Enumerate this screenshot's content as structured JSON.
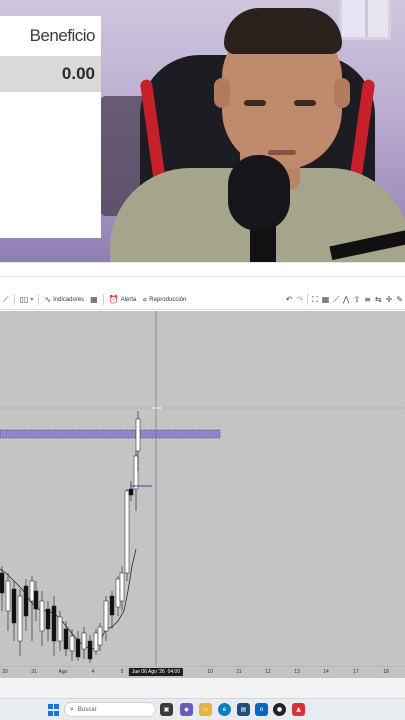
{
  "profit_panel": {
    "header": "Beneficio",
    "value": "0.00"
  },
  "toolbar": {
    "indicators_label": "Indicadores",
    "alert_label": "Alerta",
    "replay_label": "Reproducción"
  },
  "chart": {
    "x_labels": [
      "30",
      "31",
      "Ago",
      "4",
      "5",
      "10",
      "11",
      "12",
      "13",
      "14",
      "17",
      "18"
    ],
    "crosshair_label": "Jue 06 Ago '26",
    "crosshair_time": "04:00",
    "colors": {
      "background": "#c4c4c4",
      "zone": "#8e86c6",
      "candle_up": "#ffffff",
      "candle_down": "#111111"
    }
  },
  "taskbar": {
    "search_placeholder": "Buscar"
  }
}
